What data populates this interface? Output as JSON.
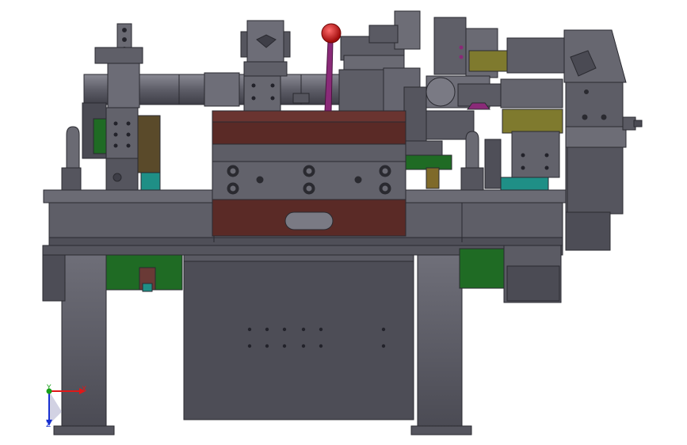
{
  "viewport": {
    "background": "#ffffff",
    "part_colors": {
      "steel": "#5d5d66",
      "steel_dark": "#3e3e47",
      "steel_light": "#7c7c86",
      "die_brown": "#5a2a26",
      "green": "#1f6b24",
      "olive": "#7f7a2e",
      "teal": "#1f8f86",
      "knob_red": "#c81414",
      "handle_purple": "#8a2a78"
    }
  },
  "triad": {
    "x_label": "X",
    "y_label": "Y",
    "z_label": "Z",
    "x_color": "#e01818",
    "y_color": "#18a018",
    "z_color": "#1830d0"
  }
}
